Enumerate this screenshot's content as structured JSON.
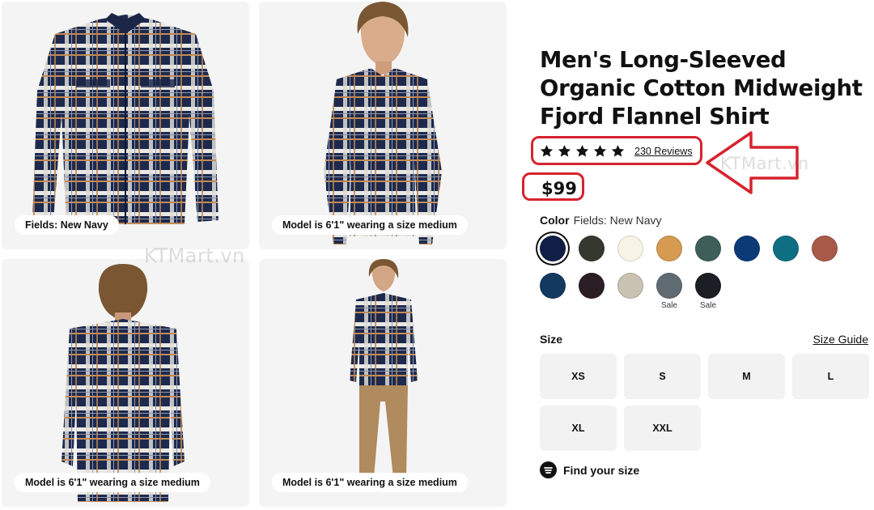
{
  "gallery": {
    "captions": [
      "Fields: New Navy",
      "Model is 6'1\" wearing a size medium",
      "Model is 6'1\" wearing a size medium",
      "Model is 6'1\" wearing a size medium"
    ]
  },
  "watermark": "KTMart.vn",
  "product": {
    "title": "Men's Long-Sleeved Organic Cotton Midweight Fjord Flannel Shirt",
    "rating": 5,
    "reviews_label": "230 Reviews",
    "price": "$99"
  },
  "color": {
    "label": "Color",
    "selected": "Fields: New Navy",
    "swatches": [
      {
        "color": "#0f1f45",
        "selected": true
      },
      {
        "color": "#35382f"
      },
      {
        "color": "#f7f3e6"
      },
      {
        "color": "#d69a51"
      },
      {
        "color": "#3e5e5a"
      },
      {
        "color": "#0b3a77"
      },
      {
        "color": "#0f6f82"
      },
      {
        "color": "#a85a49"
      },
      {
        "color": "#13395f"
      },
      {
        "color": "#2b1e24"
      },
      {
        "color": "#c9c2b3"
      },
      {
        "color": "#5f6a72",
        "sale": "Sale"
      },
      {
        "color": "#1b1e24",
        "sale": "Sale"
      }
    ]
  },
  "size": {
    "label": "Size",
    "guide_label": "Size Guide",
    "options": [
      "XS",
      "S",
      "M",
      "L",
      "XL",
      "XXL"
    ]
  },
  "find_size_label": "Find your size",
  "annotation_color": "#d6232f"
}
